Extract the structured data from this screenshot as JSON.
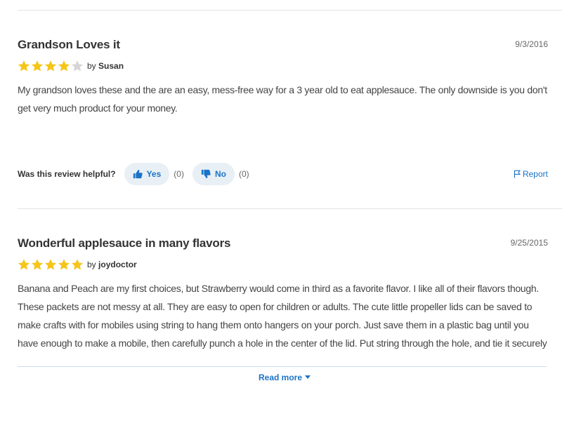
{
  "reviews": [
    {
      "title": "Grandson Loves it",
      "date": "9/3/2016",
      "rating": 4,
      "max_rating": 5,
      "by_prefix": "by",
      "author": "Susan",
      "text": "My grandson loves these and the are an easy, mess-free way for a 3 year old to eat applesauce. The only downside is you don't get very much product for your money.",
      "helpful_label": "Was this review helpful?",
      "yes_label": "Yes",
      "yes_count": "(0)",
      "no_label": "No",
      "no_count": "(0)",
      "report_label": "Report"
    },
    {
      "title": "Wonderful applesauce in many flavors",
      "date": "9/25/2015",
      "rating": 5,
      "max_rating": 5,
      "by_prefix": "by",
      "author": "joydoctor",
      "text": "Banana and Peach are my first choices, but Strawberry would come in third as a favorite flavor. I like all of their flavors though. These packets are not messy at all. They are easy to open for children or adults. The cute little propeller lids can be saved to make crafts with for mobiles using string to hang them onto hangers on your porch. Just save them in a plastic bag until you have enough to make a mobile, then carefully punch a hole in the center of the lid. Put string through the hole, and tie it securely with a knot. Then attach it to a hanger, and tie another knot to secure it to the hanger. Hang it out on your porch or",
      "read_more_label": "Read more"
    }
  ],
  "colors": {
    "star_filled": "#f5c518",
    "star_empty": "#d6d6d6",
    "accent": "#1a73c6",
    "button_bg": "#e8f0f6"
  },
  "icons": {
    "star": "star-icon",
    "thumbs_up": "thumbs-up-icon",
    "thumbs_down": "thumbs-down-icon",
    "flag": "flag-icon",
    "caret": "caret-down-icon"
  }
}
